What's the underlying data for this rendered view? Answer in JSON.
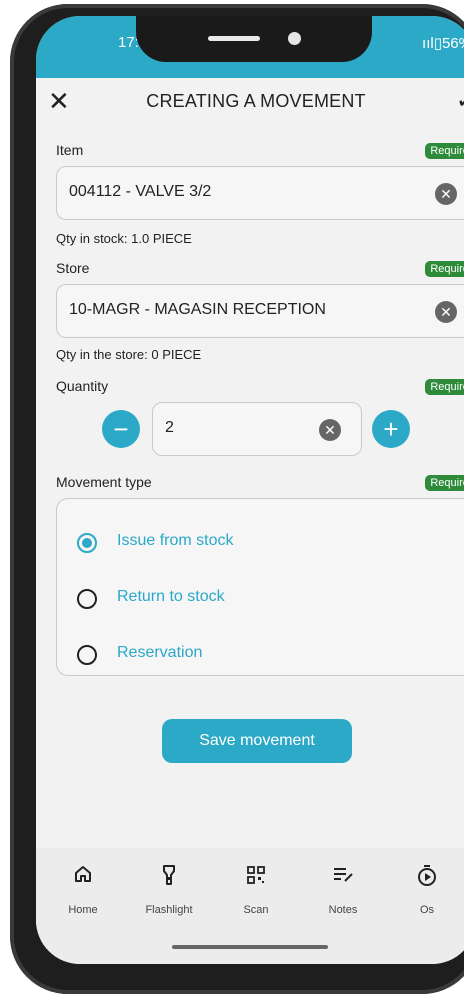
{
  "status": {
    "time": "17:",
    "indicators": "ııl▯56%"
  },
  "header": {
    "title": "CREATING A MOVEMENT",
    "close_icon": "✕",
    "confirm_icon": "✓"
  },
  "required_badge": "Required",
  "item": {
    "label": "Item",
    "value": "004112 - VALVE 3/2",
    "stock_hint": "Qty in stock: 1.0 PIECE"
  },
  "store": {
    "label": "Store",
    "value": "10-MAGR - MAGASIN RECEPTION",
    "stock_hint": "Qty in the store: 0 PIECE"
  },
  "quantity": {
    "label": "Quantity",
    "value": "2",
    "minus": "−",
    "plus": "+"
  },
  "movement_type": {
    "label": "Movement type",
    "options": [
      "Issue from stock",
      "Return to stock",
      "Reservation"
    ],
    "selected": "Issue from stock"
  },
  "save_label": "Save movement",
  "bottom_nav": [
    {
      "label": "Home",
      "icon": "home-icon"
    },
    {
      "label": "Flashlight",
      "icon": "flashlight-icon"
    },
    {
      "label": "Scan",
      "icon": "qr-scan-icon"
    },
    {
      "label": "Notes",
      "icon": "notes-icon"
    },
    {
      "label": "Os",
      "icon": "timer-icon"
    }
  ],
  "colors": {
    "accent": "#2ba9c7",
    "required_badge": "#2e8b3a"
  }
}
